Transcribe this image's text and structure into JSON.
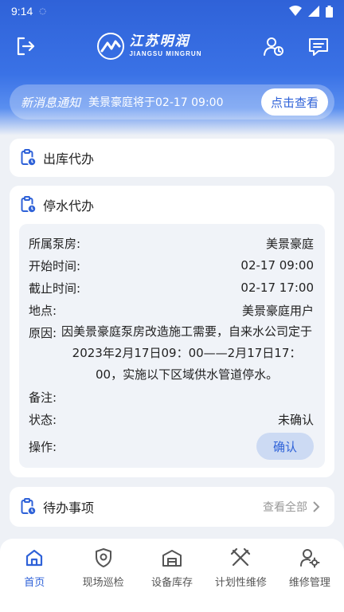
{
  "status_bar": {
    "time": "9:14"
  },
  "header": {
    "logo_cn": "江苏明润",
    "logo_en": "JIANGSU MINGRUN"
  },
  "notice": {
    "title": "新消息通知",
    "text": "美景豪庭将于02-17 09:00",
    "button": "点击查看"
  },
  "outbound": {
    "title": "出库代办"
  },
  "water": {
    "title": "停水代办",
    "fields": {
      "pump_label": "所属泵房:",
      "pump_value": "美景豪庭",
      "start_label": "开始时间:",
      "start_value": "02-17 09:00",
      "end_label": "截止时间:",
      "end_value": "02-17 17:00",
      "place_label": "地点:",
      "place_value": "美景豪庭用户",
      "reason_label": "原因:",
      "reason_value": "因美景豪庭泵房改造施工需要，自来水公司定于2023年2月17日09：00——2月17日17：00，实施以下区域供水管道停水。",
      "remark_label": "备注:",
      "remark_value": "",
      "status_label": "状态:",
      "status_value": "未确认",
      "op_label": "操作:",
      "op_button": "确认"
    }
  },
  "todo": {
    "title": "待办事项",
    "view_all": "查看全部"
  },
  "tabbar": {
    "items": [
      {
        "label": "首页",
        "icon": "home-icon",
        "active": true
      },
      {
        "label": "现场巡检",
        "icon": "shield-icon",
        "active": false
      },
      {
        "label": "设备库存",
        "icon": "warehouse-icon",
        "active": false
      },
      {
        "label": "计划性维修",
        "icon": "tools-icon",
        "active": false
      },
      {
        "label": "维修管理",
        "icon": "user-gear-icon",
        "active": false
      }
    ]
  },
  "colors": {
    "primary": "#2f62d8",
    "background": "#eef1f6",
    "active_tab": "#2f62d8"
  }
}
